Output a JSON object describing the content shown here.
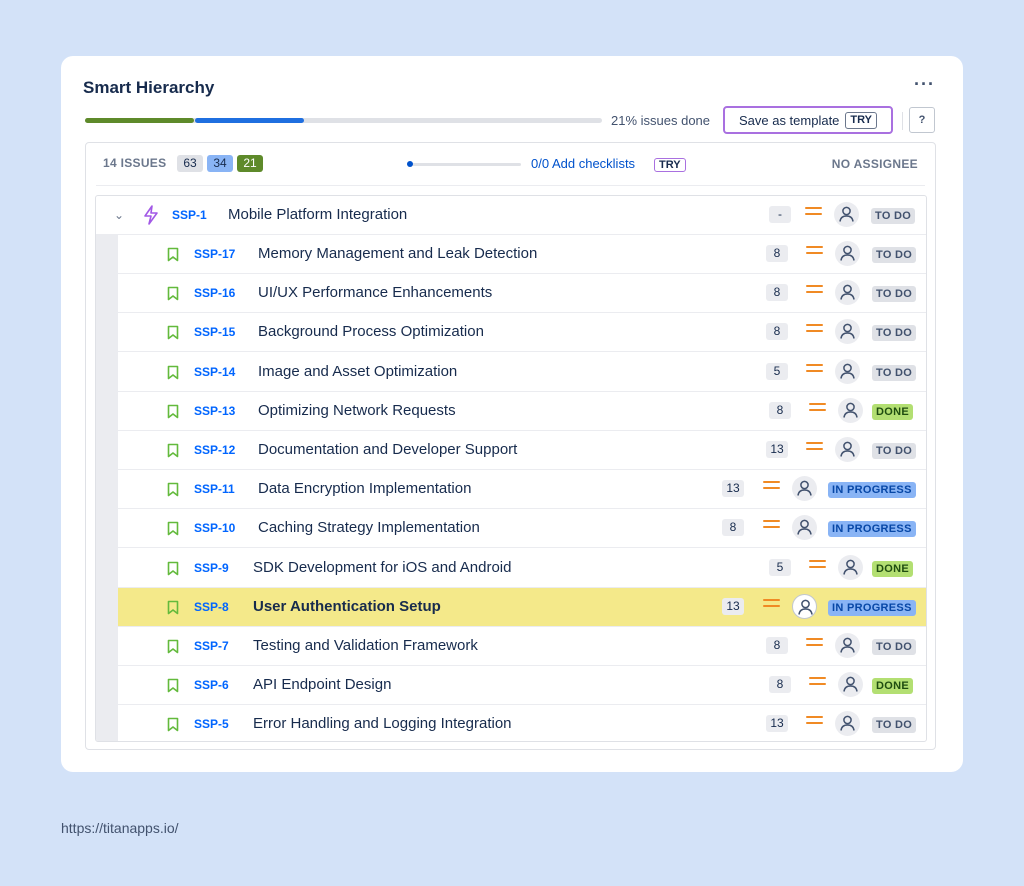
{
  "header": {
    "title": "Smart Hierarchy",
    "more_label": "···"
  },
  "progress": {
    "done_fraction": 0.21,
    "in_progress_fraction": 0.21,
    "done_color": "#5e8a2a",
    "in_progress_color": "#1f6fe0",
    "label": "21% issues done"
  },
  "save_button": {
    "label": "Save as template",
    "tag": "TRY"
  },
  "help_button": {
    "label": "?"
  },
  "stats": {
    "issues_label": "14 ISSUES",
    "counts": [
      {
        "value": "63",
        "bg": "#dfe1e6",
        "color": "#172b4d"
      },
      {
        "value": "34",
        "bg": "#89b4f5",
        "color": "#172b4d"
      },
      {
        "value": "21",
        "bg": "#5e8a2a",
        "color": "#ffffff"
      }
    ],
    "checklist_text": "0/0 Add checklists",
    "checklist_tag": "TRY",
    "assignee_label": "NO ASSIGNEE"
  },
  "parent": {
    "key": "SSP-1",
    "summary": "Mobile Platform Integration",
    "points": "-",
    "status": "TO DO",
    "icon": "epic-lightning-icon"
  },
  "children": [
    {
      "key": "SSP-17",
      "summary": "Memory Management and Leak Detection",
      "points": "8",
      "status": "TO DO"
    },
    {
      "key": "SSP-16",
      "summary": "UI/UX Performance Enhancements",
      "points": "8",
      "status": "TO DO"
    },
    {
      "key": "SSP-15",
      "summary": "Background Process Optimization",
      "points": "8",
      "status": "TO DO"
    },
    {
      "key": "SSP-14",
      "summary": "Image and Asset Optimization",
      "points": "5",
      "status": "TO DO"
    },
    {
      "key": "SSP-13",
      "summary": "Optimizing Network Requests",
      "points": "8",
      "status": "DONE"
    },
    {
      "key": "SSP-12",
      "summary": "Documentation and Developer Support",
      "points": "13",
      "status": "TO DO"
    },
    {
      "key": "SSP-11",
      "summary": "Data Encryption Implementation",
      "points": "13",
      "status": "IN PROGRESS"
    },
    {
      "key": "SSP-10",
      "summary": "Caching Strategy Implementation",
      "points": "8",
      "status": "IN PROGRESS"
    },
    {
      "key": "SSP-9",
      "summary": "SDK Development for iOS and Android",
      "points": "5",
      "status": "DONE"
    },
    {
      "key": "SSP-8",
      "summary": "User Authentication Setup",
      "points": "13",
      "status": "IN PROGRESS",
      "highlighted": true
    },
    {
      "key": "SSP-7",
      "summary": "Testing and Validation Framework",
      "points": "8",
      "status": "TO DO"
    },
    {
      "key": "SSP-6",
      "summary": "API Endpoint Design",
      "points": "8",
      "status": "DONE"
    },
    {
      "key": "SSP-5",
      "summary": "Error Handling and Logging Integration",
      "points": "13",
      "status": "TO DO"
    }
  ],
  "footer": {
    "url": "https://titanapps.io/"
  }
}
